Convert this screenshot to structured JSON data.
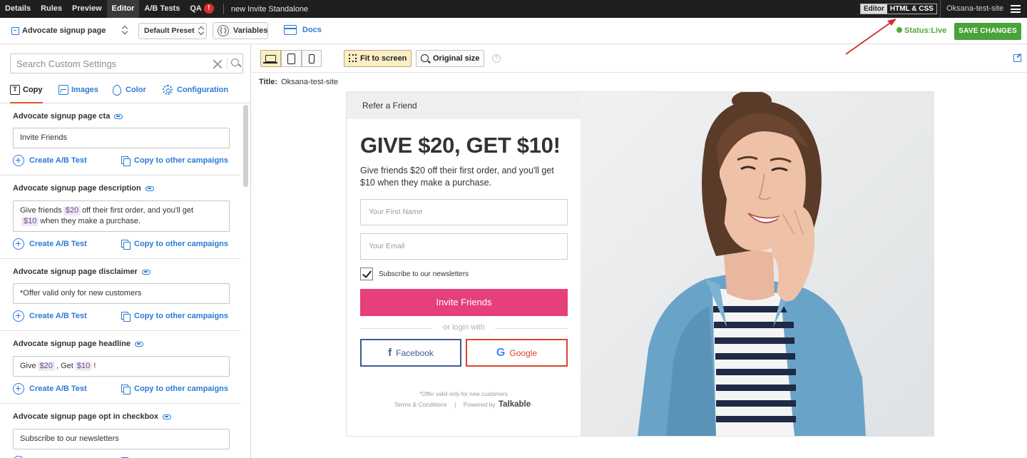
{
  "topnav": {
    "tabs": [
      "Details",
      "Rules",
      "Preview",
      "Editor",
      "A/B Tests"
    ],
    "qa_label": "QA",
    "qa_badge": "!",
    "campaign_name": "new Invite Standalone",
    "mode_editor": "Editor",
    "mode_html": "HTML & CSS",
    "site_name": "Oksana-test-site"
  },
  "toolbar": {
    "page_select": "Advocate signup page",
    "preset_select": "Default Preset",
    "variables_label": "Variables",
    "variables_icon": "{ }",
    "docs_label": "Docs",
    "status_label": "Status:",
    "status_value": "Live",
    "status_color": "#52a83b",
    "save_label": "SAVE CHANGES",
    "save_color": "#4aa23a"
  },
  "sidebar": {
    "search_placeholder": "Search Custom Settings",
    "tabs": {
      "copy": "Copy",
      "copy_icon": "T",
      "images": "Images",
      "color": "Color",
      "configuration": "Configuration"
    },
    "ab_label": "Create A/B Test",
    "copy_label": "Copy to other campaigns",
    "sections": [
      {
        "label": "Advocate signup page cta",
        "value": "Invite Friends"
      },
      {
        "label": "Advocate signup page description",
        "value_parts": [
          "Give friends",
          "$20",
          "off their first order, and you'll get",
          "$10",
          "when they make a purchase."
        ]
      },
      {
        "label": "Advocate signup page disclaimer",
        "value": "*Offer valid only for new customers"
      },
      {
        "label": "Advocate signup page headline",
        "value_parts": [
          "Give",
          "$20",
          ", Get",
          "$10",
          "!"
        ]
      },
      {
        "label": "Advocate signup page opt in checkbox",
        "value": "Subscribe to our newsletters"
      }
    ]
  },
  "preview": {
    "fit_label": "Fit to screen",
    "original_label": "Original size",
    "help_icon": "?",
    "title_label": "Title:",
    "title_value": "Oksana-test-site",
    "offer": {
      "refer_label": "Refer a Friend",
      "headline": "GIVE $20, GET $10!",
      "description": "Give friends $20 off their first order, and you'll get $10 when they make a purchase.",
      "first_name_placeholder": "Your First Name",
      "email_placeholder": "Your Email",
      "subscribe_label": "Subscribe to our newsletters",
      "invite_label": "Invite Friends",
      "invite_color": "#e53f7c",
      "or_login": "or login with",
      "facebook_icon": "f",
      "facebook_label": "Facebook",
      "google_icon": "G",
      "google_label": "Google",
      "disclaimer": "*Offer valid only for new customers",
      "terms_label": "Terms & Conditions",
      "pipe": "|",
      "powered_by": "Powered by",
      "brand": "Talkable"
    }
  }
}
